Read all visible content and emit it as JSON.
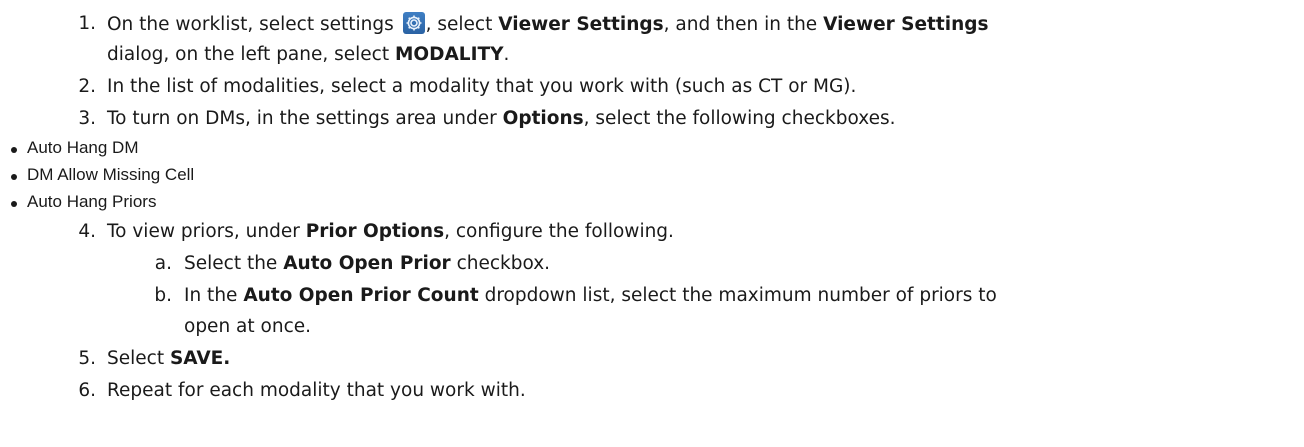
{
  "step1": {
    "number": "1.",
    "text_a": "On the worklist, select settings",
    "text_b": ", select",
    "bold_viewer_settings": "Viewer Settings",
    "text_c": ", and then in the",
    "bold_viewer_settings_2": "Viewer Settings",
    "text_d": "dialog, on the left pane, select",
    "bold_modality": "MODALITY",
    "text_e": ".",
    "icon": "gear-icon"
  },
  "step2": {
    "number": "2.",
    "text": "In the list of modalities, select a modality that you work with (such as CT or MG)."
  },
  "step3": {
    "number": "3.",
    "text_a": "To turn on DMs, in the settings area under",
    "bold_options": "Options",
    "text_b": ", select the following checkboxes."
  },
  "bullets": [
    "Auto Hang DM",
    "DM Allow Missing Cell",
    "Auto Hang Priors"
  ],
  "step4": {
    "number": "4.",
    "text_a": "To view priors, under",
    "bold_prior_options": "Prior Options",
    "text_b": ", configure the following.",
    "sub_a": {
      "letter": "a.",
      "text_a": "Select the",
      "bold": "Auto Open Prior",
      "text_b": "checkbox."
    },
    "sub_b": {
      "letter": "b.",
      "text_a": "In the",
      "bold": "Auto Open Prior Count",
      "text_b": "dropdown list, select the maximum number of priors to",
      "text_c": "open at once."
    }
  },
  "step5": {
    "number": "5.",
    "text_a": "Select",
    "bold_save": "SAVE."
  },
  "step6": {
    "number": "6.",
    "text": "Repeat for each modality that you work with."
  }
}
